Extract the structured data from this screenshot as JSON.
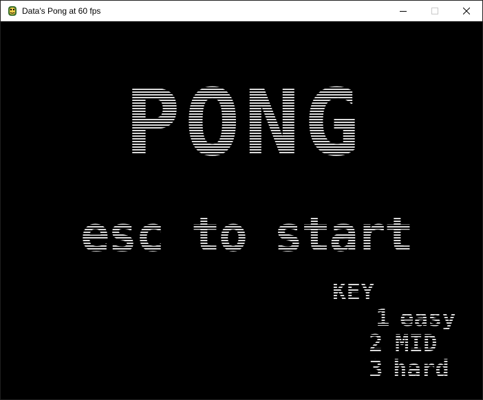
{
  "window": {
    "title": "Data's Pong at 60 fps",
    "icon": "python-snake-icon",
    "controls": {
      "minimize": "minimize-icon",
      "maximize": "maximize-icon",
      "close": "close-icon"
    }
  },
  "game": {
    "background": "#000000",
    "text_color": "#dcdcdc",
    "title": "PONG",
    "prompt": "esc to start",
    "key": {
      "heading": "KEY",
      "items": [
        {
          "key": "1",
          "label": "easy"
        },
        {
          "key": "2",
          "label": "MID"
        },
        {
          "key": "3",
          "label": "hard"
        }
      ]
    }
  }
}
